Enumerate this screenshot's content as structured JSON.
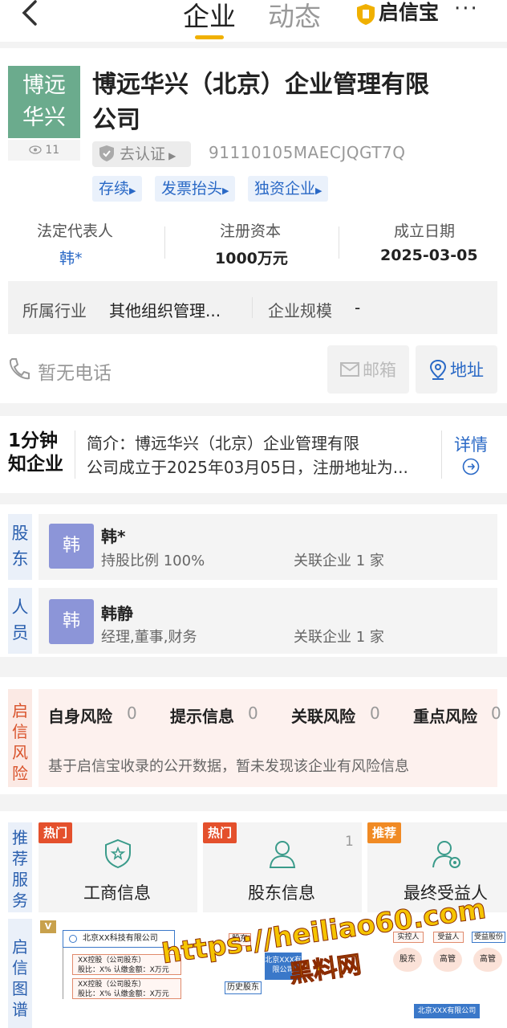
{
  "header": {
    "tabs": [
      "企业",
      "动态"
    ],
    "brand": "启信宝",
    "more": "···"
  },
  "company": {
    "logo_line1": "博远",
    "logo_line2": "华兴",
    "views": "11",
    "name_line1": "博远华兴（北京）企业管理有限",
    "name_line2": "公司",
    "cert": "去认证",
    "credit_code": "91110105MAECJQGT7Q",
    "tags": [
      "存续",
      "发票抬头",
      "独资企业"
    ],
    "stats": [
      {
        "label": "法定代表人",
        "value": "韩*"
      },
      {
        "label": "注册资本",
        "value": "1000万元"
      },
      {
        "label": "成立日期",
        "value": "2025-03-05"
      }
    ],
    "industry_label": "所属行业",
    "industry_value": "其他组织管理...",
    "scale_label": "企业规模",
    "scale_value": "-",
    "phone": "暂无电话",
    "email_btn": "邮箱",
    "address_btn": "地址"
  },
  "intro": {
    "badge_line1": "1分钟",
    "badge_line2": "知企业",
    "text_line1": "简介：博远华兴（北京）企业管理有限",
    "text_line2": "公司成立于2025年03月05日，注册地址为...",
    "detail": "详情"
  },
  "people": {
    "shareholder_head": "股东",
    "staff_head": "人员",
    "shareholder_avatar": "韩",
    "shareholder_name": "韩*",
    "shareholder_desc": "持股比例 100%",
    "shareholder_rel": "关联企业 1 家",
    "staff_avatar": "韩",
    "staff_name": "韩静",
    "staff_desc": "经理,董事,财务",
    "staff_rel": "关联企业 1 家"
  },
  "risk": {
    "head": "启信风险",
    "items": [
      {
        "label": "自身风险",
        "count": "0"
      },
      {
        "label": "提示信息",
        "count": "0"
      },
      {
        "label": "关联风险",
        "count": "0"
      },
      {
        "label": "重点风险",
        "count": "0"
      }
    ],
    "note": "基于启信宝收录的公开数据，暂未发现该企业有风险信息"
  },
  "services": {
    "head": "推荐服务",
    "items": [
      {
        "badge": "热门",
        "label": "工商信息",
        "count": ""
      },
      {
        "badge": "热门",
        "label": "股东信息",
        "count": "1"
      },
      {
        "badge": "推荐",
        "label": "最终受益人",
        "count": ""
      }
    ]
  },
  "graph": {
    "head": "启信图谱",
    "v_badge": "V",
    "company1": "北京XX科技有限公司",
    "node1": "XX控股（公司股东）",
    "node1_sub": "股比：X%   认缴金额：X万元",
    "node2": "XX控股（公司股东）",
    "node2_sub": "股比：X%   认缴金额：X万元",
    "g2_top": "股东",
    "g2_center": "北京XXX有限公司",
    "g2_left": "历史股东",
    "g3_a": "实控人",
    "g3_b": "受益人",
    "g3_c": "受益股份",
    "g3_d": "股东",
    "g3_e": "高管",
    "g3_f": "高管",
    "g3_company": "北京XXX有限公司"
  },
  "watermark": {
    "url": "https://heiliao60.com",
    "name": "黑料网"
  },
  "colors": {
    "accent": "#f0b000",
    "link": "#2a69c6",
    "risk": "#e4502c",
    "logo": "#6bab8d"
  }
}
